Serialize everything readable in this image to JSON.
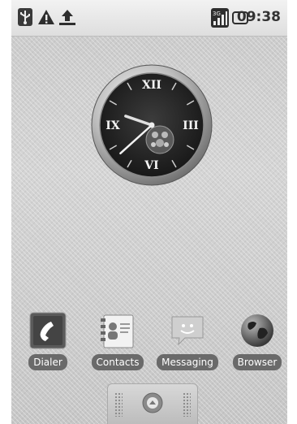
{
  "status_bar": {
    "time": "09:38",
    "icons": [
      "usb-icon",
      "warning-icon",
      "upload-icon",
      "network-3g-signal-icon",
      "battery-icon"
    ]
  },
  "clock_widget": {
    "hour": 9,
    "minute": 38,
    "numerals": [
      "XII",
      "III",
      "VI",
      "IX"
    ]
  },
  "dock": {
    "apps": [
      {
        "label": "Dialer",
        "icon": "phone-icon"
      },
      {
        "label": "Contacts",
        "icon": "contacts-icon"
      },
      {
        "label": "Messaging",
        "icon": "messaging-icon"
      },
      {
        "label": "Browser",
        "icon": "globe-icon"
      }
    ]
  },
  "app_drawer": {
    "icon": "chevron-up-icon"
  }
}
